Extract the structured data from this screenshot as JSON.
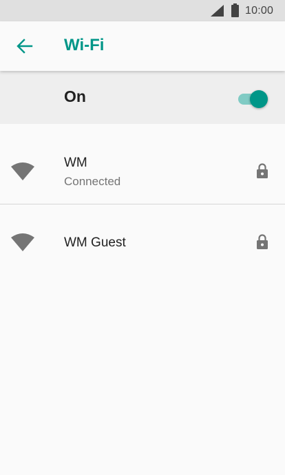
{
  "status_bar": {
    "time": "10:00",
    "icons": [
      "cellular-signal-icon",
      "battery-icon"
    ]
  },
  "toolbar": {
    "title": "Wi-Fi",
    "back_icon": "arrow-back-icon"
  },
  "wifi_switch": {
    "label": "On",
    "state": "on"
  },
  "networks": [
    {
      "name": "WM",
      "status": "Connected",
      "secured": true,
      "icon": "wifi-icon"
    },
    {
      "name": "WM Guest",
      "status": "",
      "secured": true,
      "icon": "wifi-icon"
    }
  ],
  "colors": {
    "accent": "#009688",
    "accent_light": "#80cbc4",
    "status_bar_bg": "#e0e0e0",
    "switch_bar_bg": "#eeeeee",
    "page_bg": "#fafafa",
    "icon_gray": "#757575"
  }
}
